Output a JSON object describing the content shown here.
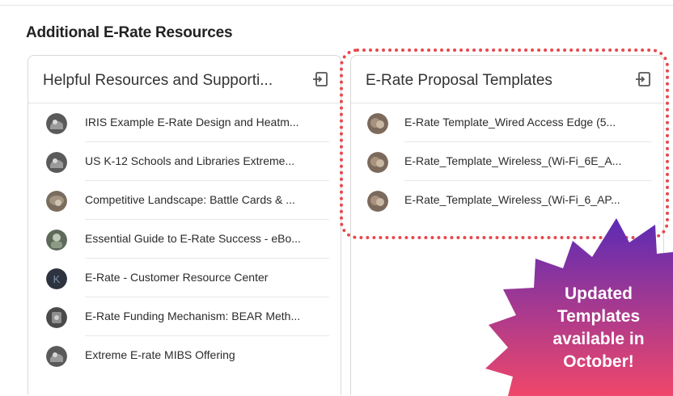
{
  "section": {
    "title": "Additional E-Rate Resources"
  },
  "cards": [
    {
      "title": "Helpful Resources and Supporti...",
      "items": [
        "IRIS Example E-Rate Design and Heatm...",
        "US K-12 Schools and Libraries Extreme...",
        "Competitive Landscape: Battle Cards & ...",
        "Essential Guide to E-Rate Success - eBo...",
        "E-Rate - Customer Resource Center",
        "E-Rate Funding Mechanism: BEAR Meth...",
        "Extreme E-rate MIBS Offering"
      ]
    },
    {
      "title": "E-Rate Proposal Templates",
      "items": [
        "E-Rate Template_Wired Access Edge (5...",
        "E-Rate_Template_Wireless_(Wi-Fi_6E_A...",
        "E-Rate_Template_Wireless_(Wi-Fi_6_AP..."
      ]
    }
  ],
  "callout": {
    "lines": [
      "Updated",
      "Templates",
      "available in",
      "October!"
    ],
    "gradient_top": "#5b2bb5",
    "gradient_bottom": "#f0476a"
  },
  "highlight_color": "#e8484d",
  "icons": {
    "open": "open-in-icon",
    "avatar": "file-avatar-icon"
  }
}
